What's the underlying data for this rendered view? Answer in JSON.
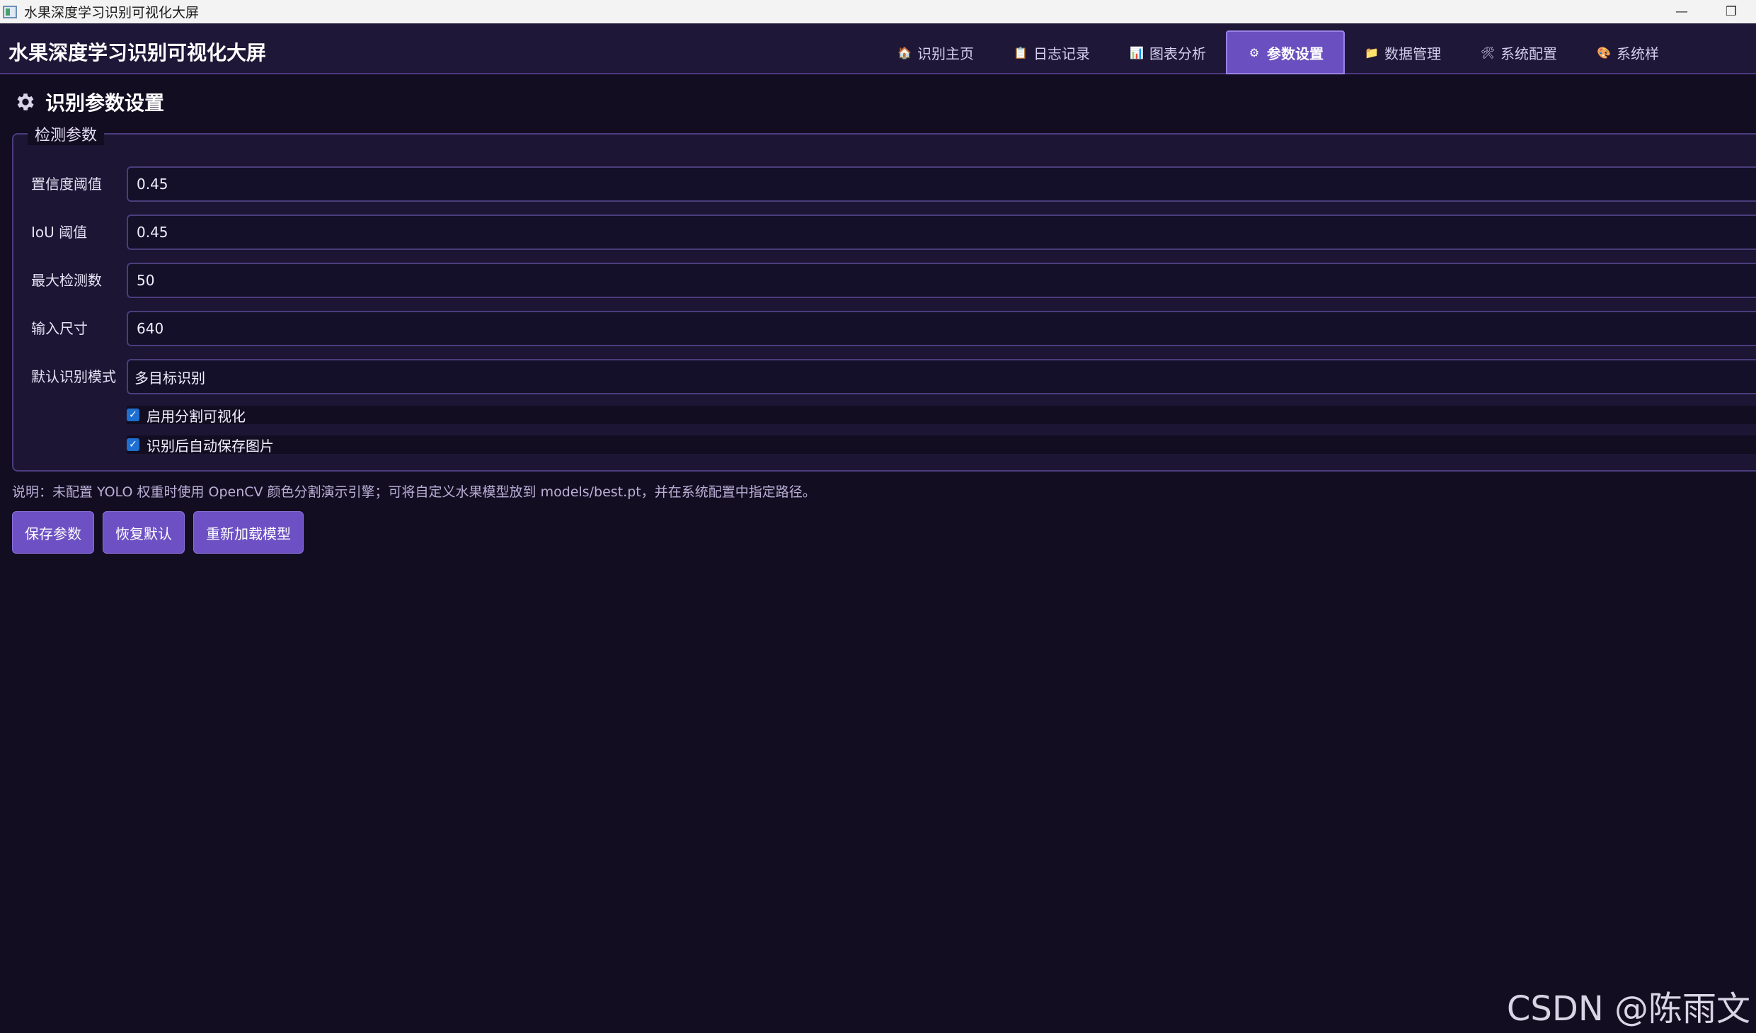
{
  "window": {
    "title": "水果深度学习识别可视化大屏",
    "minimize_glyph": "—",
    "restore_glyph": "❐"
  },
  "header": {
    "app_title": "水果深度学习识别可视化大屏",
    "tabs": [
      {
        "label": "识别主页",
        "icon": "home-icon",
        "glyph": "🏠"
      },
      {
        "label": "日志记录",
        "icon": "clipboard-icon",
        "glyph": "📋"
      },
      {
        "label": "图表分析",
        "icon": "bar-chart-icon",
        "glyph": "📊"
      },
      {
        "label": "参数设置",
        "icon": "gear-icon",
        "glyph": "⚙",
        "active": true
      },
      {
        "label": "数据管理",
        "icon": "folder-icon",
        "glyph": "📁"
      },
      {
        "label": "系统配置",
        "icon": "tools-icon",
        "glyph": "🛠"
      },
      {
        "label": "系统样",
        "icon": "palette-icon",
        "glyph": "🎨"
      }
    ]
  },
  "page": {
    "heading": "识别参数设置"
  },
  "group": {
    "legend": "检测参数",
    "fields": [
      {
        "label": "置信度阈值",
        "value": "0.45"
      },
      {
        "label": "IoU 阈值",
        "value": "0.45"
      },
      {
        "label": "最大检测数",
        "value": "50"
      },
      {
        "label": "输入尺寸",
        "value": "640"
      },
      {
        "label": "默认识别模式",
        "value": "多目标识别"
      }
    ],
    "checkboxes": [
      {
        "label": "启用分割可视化",
        "checked": true
      },
      {
        "label": "识别后自动保存图片",
        "checked": true
      }
    ]
  },
  "note": "说明：未配置 YOLO 权重时使用 OpenCV 颜色分割演示引擎；可将自定义水果模型放到 models/best.pt，并在系统配置中指定路径。",
  "buttons": {
    "save": "保存参数",
    "reset": "恢复默认",
    "reload": "重新加载模型"
  },
  "watermark": "CSDN @陈雨文",
  "colors": {
    "background": "#130d22",
    "accent": "#6d51c4",
    "checkbox": "#1d6fd1"
  }
}
